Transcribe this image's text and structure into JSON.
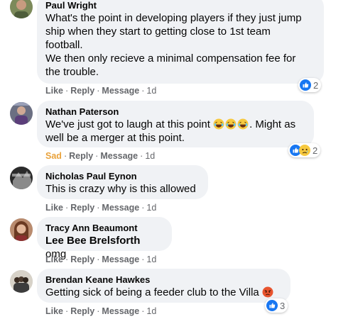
{
  "comments": [
    {
      "author": "Paul Wright",
      "lines": [
        "What's the point in developing players if they just jump",
        "ship when they start to getting close to 1st team",
        "football.",
        "We then only recieve a minimal compensation fee for",
        "the trouble."
      ],
      "actions": {
        "like": "Like",
        "reply": "Reply",
        "message": "Message",
        "time": "1d"
      },
      "reactions": {
        "types": [
          "like-icon"
        ],
        "count": "2"
      }
    },
    {
      "author": "Nathan Paterson",
      "text_before": "We've just got to laugh at this point",
      "emojis": [
        "laughing-emoji",
        "laughing-emoji",
        "laughing-emoji"
      ],
      "text_after": ". Might as",
      "line2": "well be a merger at this point.",
      "actions": {
        "like": "Sad",
        "reply": "Reply",
        "message": "Message",
        "time": "1d"
      },
      "reactions": {
        "types": [
          "like-icon",
          "sad-icon"
        ],
        "count": "2"
      }
    },
    {
      "author": "Nicholas Paul Eynon",
      "text": "This is crazy why is this allowed",
      "actions": {
        "like": "Like",
        "reply": "Reply",
        "message": "Message",
        "time": "1d"
      }
    },
    {
      "author": "Tracy Ann Beaumont",
      "mention": "Lee Bee Brelsforth",
      "text": " omg",
      "actions": {
        "like": "Like",
        "reply": "Reply",
        "message": "Message",
        "time": "1d"
      }
    },
    {
      "author": "Brendan Keane Hawkes",
      "text": "Getting sick of being a feeder club to the Villa",
      "emoji": "angry-emoji",
      "actions": {
        "like": "Like",
        "reply": "Reply",
        "message": "Message",
        "time": "1d"
      },
      "reactions": {
        "types": [
          "like-icon"
        ],
        "count": "3"
      }
    }
  ],
  "colors": {
    "bubble": "#f0f2f5",
    "action_text": "#65676b",
    "like_blue": "#1877f2",
    "sad_yellow": "#e9a23b"
  },
  "separator": "·"
}
